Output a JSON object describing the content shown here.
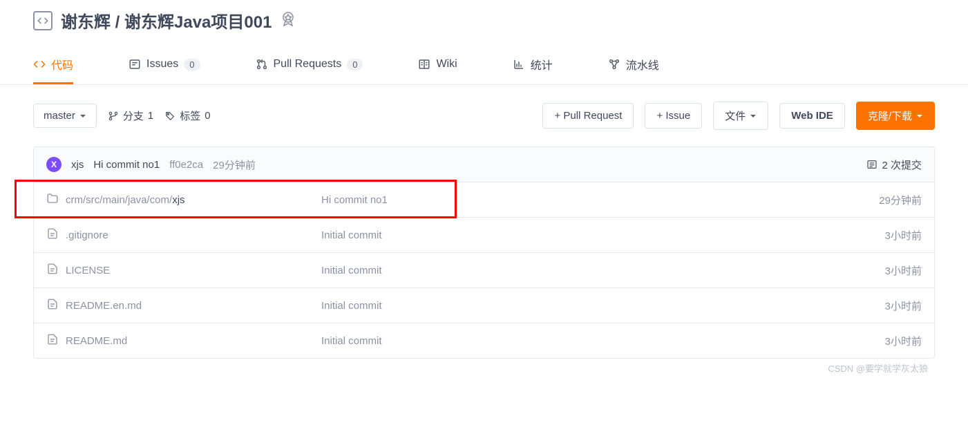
{
  "header": {
    "owner": "谢东辉",
    "separator": "/",
    "repo": "谢东辉Java项目001"
  },
  "tabs": [
    {
      "label": "代码",
      "active": true
    },
    {
      "label": "Issues",
      "count": "0"
    },
    {
      "label": "Pull Requests",
      "count": "0"
    },
    {
      "label": "Wiki"
    },
    {
      "label": "统计"
    },
    {
      "label": "流水线"
    }
  ],
  "toolbar": {
    "branch": "master",
    "branches_label": "分支",
    "branches_count": "1",
    "tags_label": "标签",
    "tags_count": "0",
    "pull_request": "+ Pull Request",
    "issue": "+ Issue",
    "files": "文件",
    "web_ide": "Web IDE",
    "clone": "克隆/下载"
  },
  "commit_bar": {
    "avatar": "X",
    "user": "xjs",
    "message": "Hi commit no1",
    "hash": "ff0e2ca",
    "time": "29分钟前",
    "count_label": "2 次提交"
  },
  "files": [
    {
      "type": "folder",
      "name_prefix": "crm/src/main/java/com/",
      "name_highlight": "xjs",
      "message": "Hi commit no1",
      "time": "29分钟前",
      "highlighted": true
    },
    {
      "type": "file",
      "name": ".gitignore",
      "message": "Initial commit",
      "time": "3小时前"
    },
    {
      "type": "file",
      "name": "LICENSE",
      "message": "Initial commit",
      "time": "3小时前"
    },
    {
      "type": "file",
      "name": "README.en.md",
      "message": "Initial commit",
      "time": "3小时前"
    },
    {
      "type": "file",
      "name": "README.md",
      "message": "Initial commit",
      "time": "3小时前"
    }
  ],
  "watermark": "CSDN @要学就学灰太狼"
}
